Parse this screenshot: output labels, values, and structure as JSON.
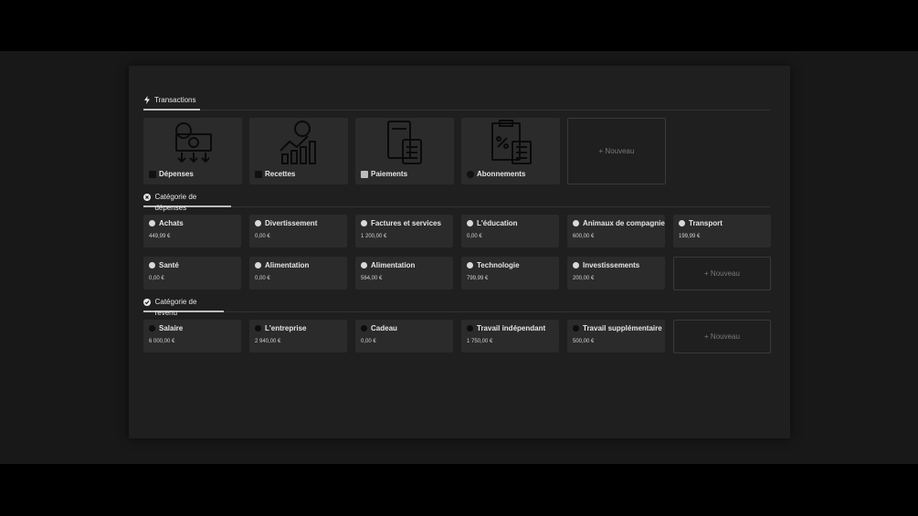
{
  "sections": {
    "transactions": {
      "title": "Transactions",
      "cards": [
        {
          "label": "Dépenses",
          "icon": "money-arrows-icon"
        },
        {
          "label": "Recettes",
          "icon": "growth-chart-icon"
        },
        {
          "label": "Paiements",
          "icon": "card-payment-icon"
        },
        {
          "label": "Abonnements",
          "icon": "calculator-clipboard-icon"
        }
      ],
      "new_label": "+ Nouveau"
    },
    "expense_categories": {
      "title": "Catégorie de dépenses",
      "items": [
        {
          "name": "Achats",
          "amount": "449,99 €"
        },
        {
          "name": "Divertissement",
          "amount": "0,00 €"
        },
        {
          "name": "Factures et services",
          "amount": "1 200,00 €"
        },
        {
          "name": "L'éducation",
          "amount": "0,00 €"
        },
        {
          "name": "Animaux de compagnie",
          "amount": "600,00 €"
        },
        {
          "name": "Transport",
          "amount": "199,99 €"
        },
        {
          "name": "Santé",
          "amount": "0,00 €"
        },
        {
          "name": "Alimentation",
          "amount": "0,00 €"
        },
        {
          "name": "Alimentation",
          "amount": "564,00 €"
        },
        {
          "name": "Technologie",
          "amount": "799,99 €"
        },
        {
          "name": "Investissements",
          "amount": "200,00 €"
        }
      ],
      "new_label": "+ Nouveau"
    },
    "income_categories": {
      "title": "Catégorie de revenu",
      "items": [
        {
          "name": "Salaire",
          "amount": "6 000,00 €"
        },
        {
          "name": "L'entreprise",
          "amount": "2 940,00 €"
        },
        {
          "name": "Cadeau",
          "amount": "0,00 €"
        },
        {
          "name": "Travail indépendant",
          "amount": "1 750,00 €"
        },
        {
          "name": "Travail supplémentaire",
          "amount": "500,00 €"
        }
      ],
      "new_label": "+ Nouveau"
    }
  },
  "colors": {
    "background": "#181818",
    "panel": "#1f1f1f",
    "card": "#2b2b2b",
    "text": "#e6e6e6"
  }
}
